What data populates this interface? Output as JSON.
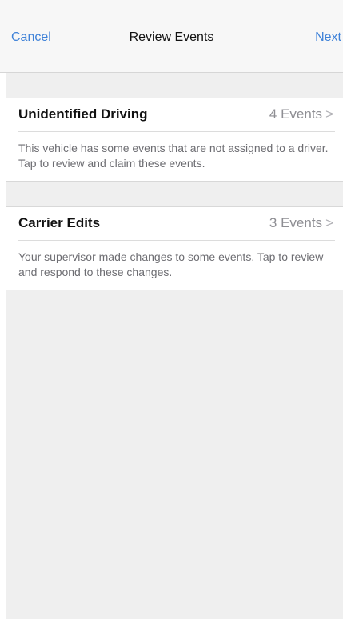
{
  "navbar": {
    "cancel_label": "Cancel",
    "title": "Review Events",
    "next_label": "Next"
  },
  "sections": [
    {
      "title": "Unidentified Driving",
      "count": "4 Events",
      "description": "This vehicle has some events that are not assigned to a driver. Tap to review and claim these events."
    },
    {
      "title": "Carrier Edits",
      "count": "3 Events",
      "description": "Your supervisor made changes to some events. Tap to review and respond to these changes."
    }
  ],
  "icons": {
    "chevron": "chevron-right-icon"
  },
  "colors": {
    "accent": "#3f82d8",
    "background": "#efefef"
  }
}
